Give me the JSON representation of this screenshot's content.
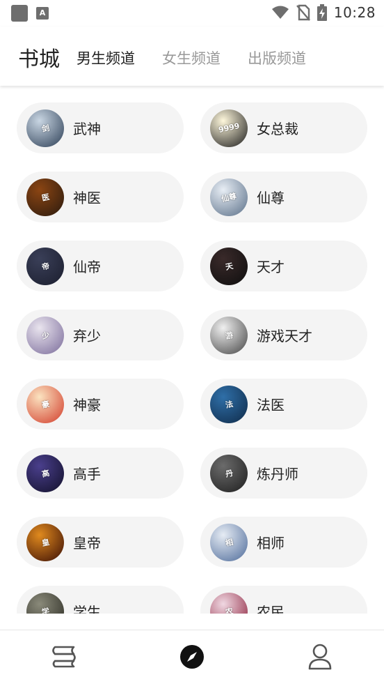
{
  "status_bar": {
    "time": "10:28",
    "app_badge": "A"
  },
  "header": {
    "title": "书城",
    "tabs": [
      {
        "label": "男生频道",
        "active": true
      },
      {
        "label": "女生频道",
        "active": false
      },
      {
        "label": "出版频道",
        "active": false
      }
    ]
  },
  "categories": [
    {
      "label": "武神",
      "cover_text": "剑",
      "cover_colors": [
        "#c9d6e3",
        "#2c3e55"
      ]
    },
    {
      "label": "女总裁",
      "cover_text": "9999",
      "cover_colors": [
        "#fff8dc",
        "#1a1a1a"
      ]
    },
    {
      "label": "神医",
      "cover_text": "医",
      "cover_colors": [
        "#8b4513",
        "#2a1a0e"
      ]
    },
    {
      "label": "仙尊",
      "cover_text": "仙尊",
      "cover_colors": [
        "#e8eef5",
        "#5a6f88"
      ]
    },
    {
      "label": "仙帝",
      "cover_text": "帝",
      "cover_colors": [
        "#3a3f58",
        "#1b1e2e"
      ]
    },
    {
      "label": "天才",
      "cover_text": "天",
      "cover_colors": [
        "#3a2a2a",
        "#0e0e0e"
      ]
    },
    {
      "label": "弃少",
      "cover_text": "少",
      "cover_colors": [
        "#e9e4ee",
        "#7a6b9a"
      ]
    },
    {
      "label": "游戏天才",
      "cover_text": "游",
      "cover_colors": [
        "#f0f0f0",
        "#444444"
      ]
    },
    {
      "label": "神豪",
      "cover_text": "豪",
      "cover_colors": [
        "#fbe3c0",
        "#d23c2a"
      ]
    },
    {
      "label": "法医",
      "cover_text": "法",
      "cover_colors": [
        "#2f6fa8",
        "#0f2a48"
      ]
    },
    {
      "label": "高手",
      "cover_text": "高",
      "cover_colors": [
        "#4a3f8c",
        "#12102a"
      ]
    },
    {
      "label": "炼丹师",
      "cover_text": "丹",
      "cover_colors": [
        "#6b6b6b",
        "#1e1e1e"
      ]
    },
    {
      "label": "皇帝",
      "cover_text": "皇",
      "cover_colors": [
        "#e08a1e",
        "#3a0d05"
      ]
    },
    {
      "label": "相师",
      "cover_text": "相",
      "cover_colors": [
        "#e6ecf4",
        "#4d6a99"
      ]
    },
    {
      "label": "学生",
      "cover_text": "学",
      "cover_colors": [
        "#8a8a7a",
        "#2a2a22"
      ]
    },
    {
      "label": "农民",
      "cover_text": "农",
      "cover_colors": [
        "#f0d8e2",
        "#8a1f3a"
      ]
    }
  ],
  "bottom_nav": [
    {
      "name": "bookshelf",
      "icon": "stacked-books-icon",
      "active": false
    },
    {
      "name": "discover",
      "icon": "compass-icon",
      "active": true
    },
    {
      "name": "profile",
      "icon": "person-icon",
      "active": false
    }
  ]
}
